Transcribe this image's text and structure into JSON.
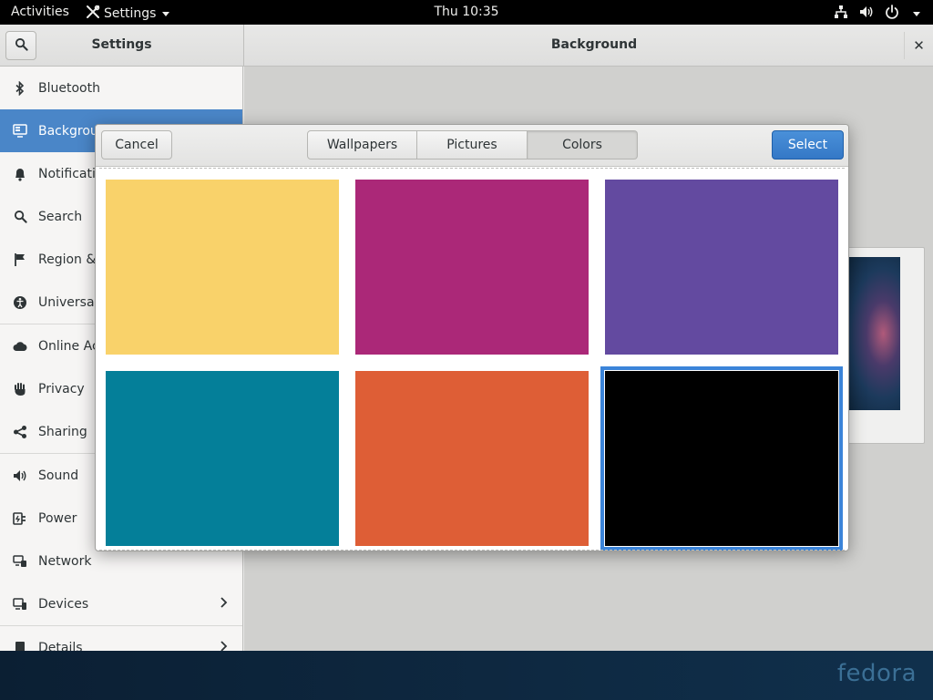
{
  "topbar": {
    "activities": "Activities",
    "app_name": "Settings",
    "clock": "Thu 10:35"
  },
  "window": {
    "sidebar_title": "Settings",
    "page_title": "Background",
    "close_glyph": "✕"
  },
  "sidebar": {
    "items": [
      {
        "label": "Bluetooth",
        "icon": "bluetooth-icon"
      },
      {
        "label": "Background",
        "icon": "display-icon"
      },
      {
        "label": "Notifications",
        "icon": "bell-icon"
      },
      {
        "label": "Search",
        "icon": "search-icon"
      },
      {
        "label": "Region & Language",
        "icon": "flag-icon"
      },
      {
        "label": "Universal Access",
        "icon": "accessibility-icon"
      },
      {
        "label": "Online Accounts",
        "icon": "cloud-icon"
      },
      {
        "label": "Privacy",
        "icon": "hand-icon"
      },
      {
        "label": "Sharing",
        "icon": "share-icon"
      },
      {
        "label": "Sound",
        "icon": "speaker-icon"
      },
      {
        "label": "Power",
        "icon": "power-plug-icon"
      },
      {
        "label": "Network",
        "icon": "network-icon"
      },
      {
        "label": "Devices",
        "icon": "devices-icon"
      },
      {
        "label": "Details",
        "icon": "info-icon"
      }
    ]
  },
  "dialog": {
    "cancel_label": "Cancel",
    "select_label": "Select",
    "tabs": [
      {
        "label": "Wallpapers"
      },
      {
        "label": "Pictures"
      },
      {
        "label": "Colors"
      }
    ],
    "active_tab": "Colors",
    "swatches": [
      {
        "color": "#f9d26a"
      },
      {
        "color": "#ab2878"
      },
      {
        "color": "#634aa0"
      },
      {
        "color": "#047f99"
      },
      {
        "color": "#de5e36"
      },
      {
        "color": "#000000"
      }
    ],
    "selected_swatch_index": 5
  },
  "desktop": {
    "brand": "fedora"
  },
  "colors": {
    "accent": "#4a86c8",
    "select_button": "#3478c6",
    "topbar": "#000000"
  }
}
